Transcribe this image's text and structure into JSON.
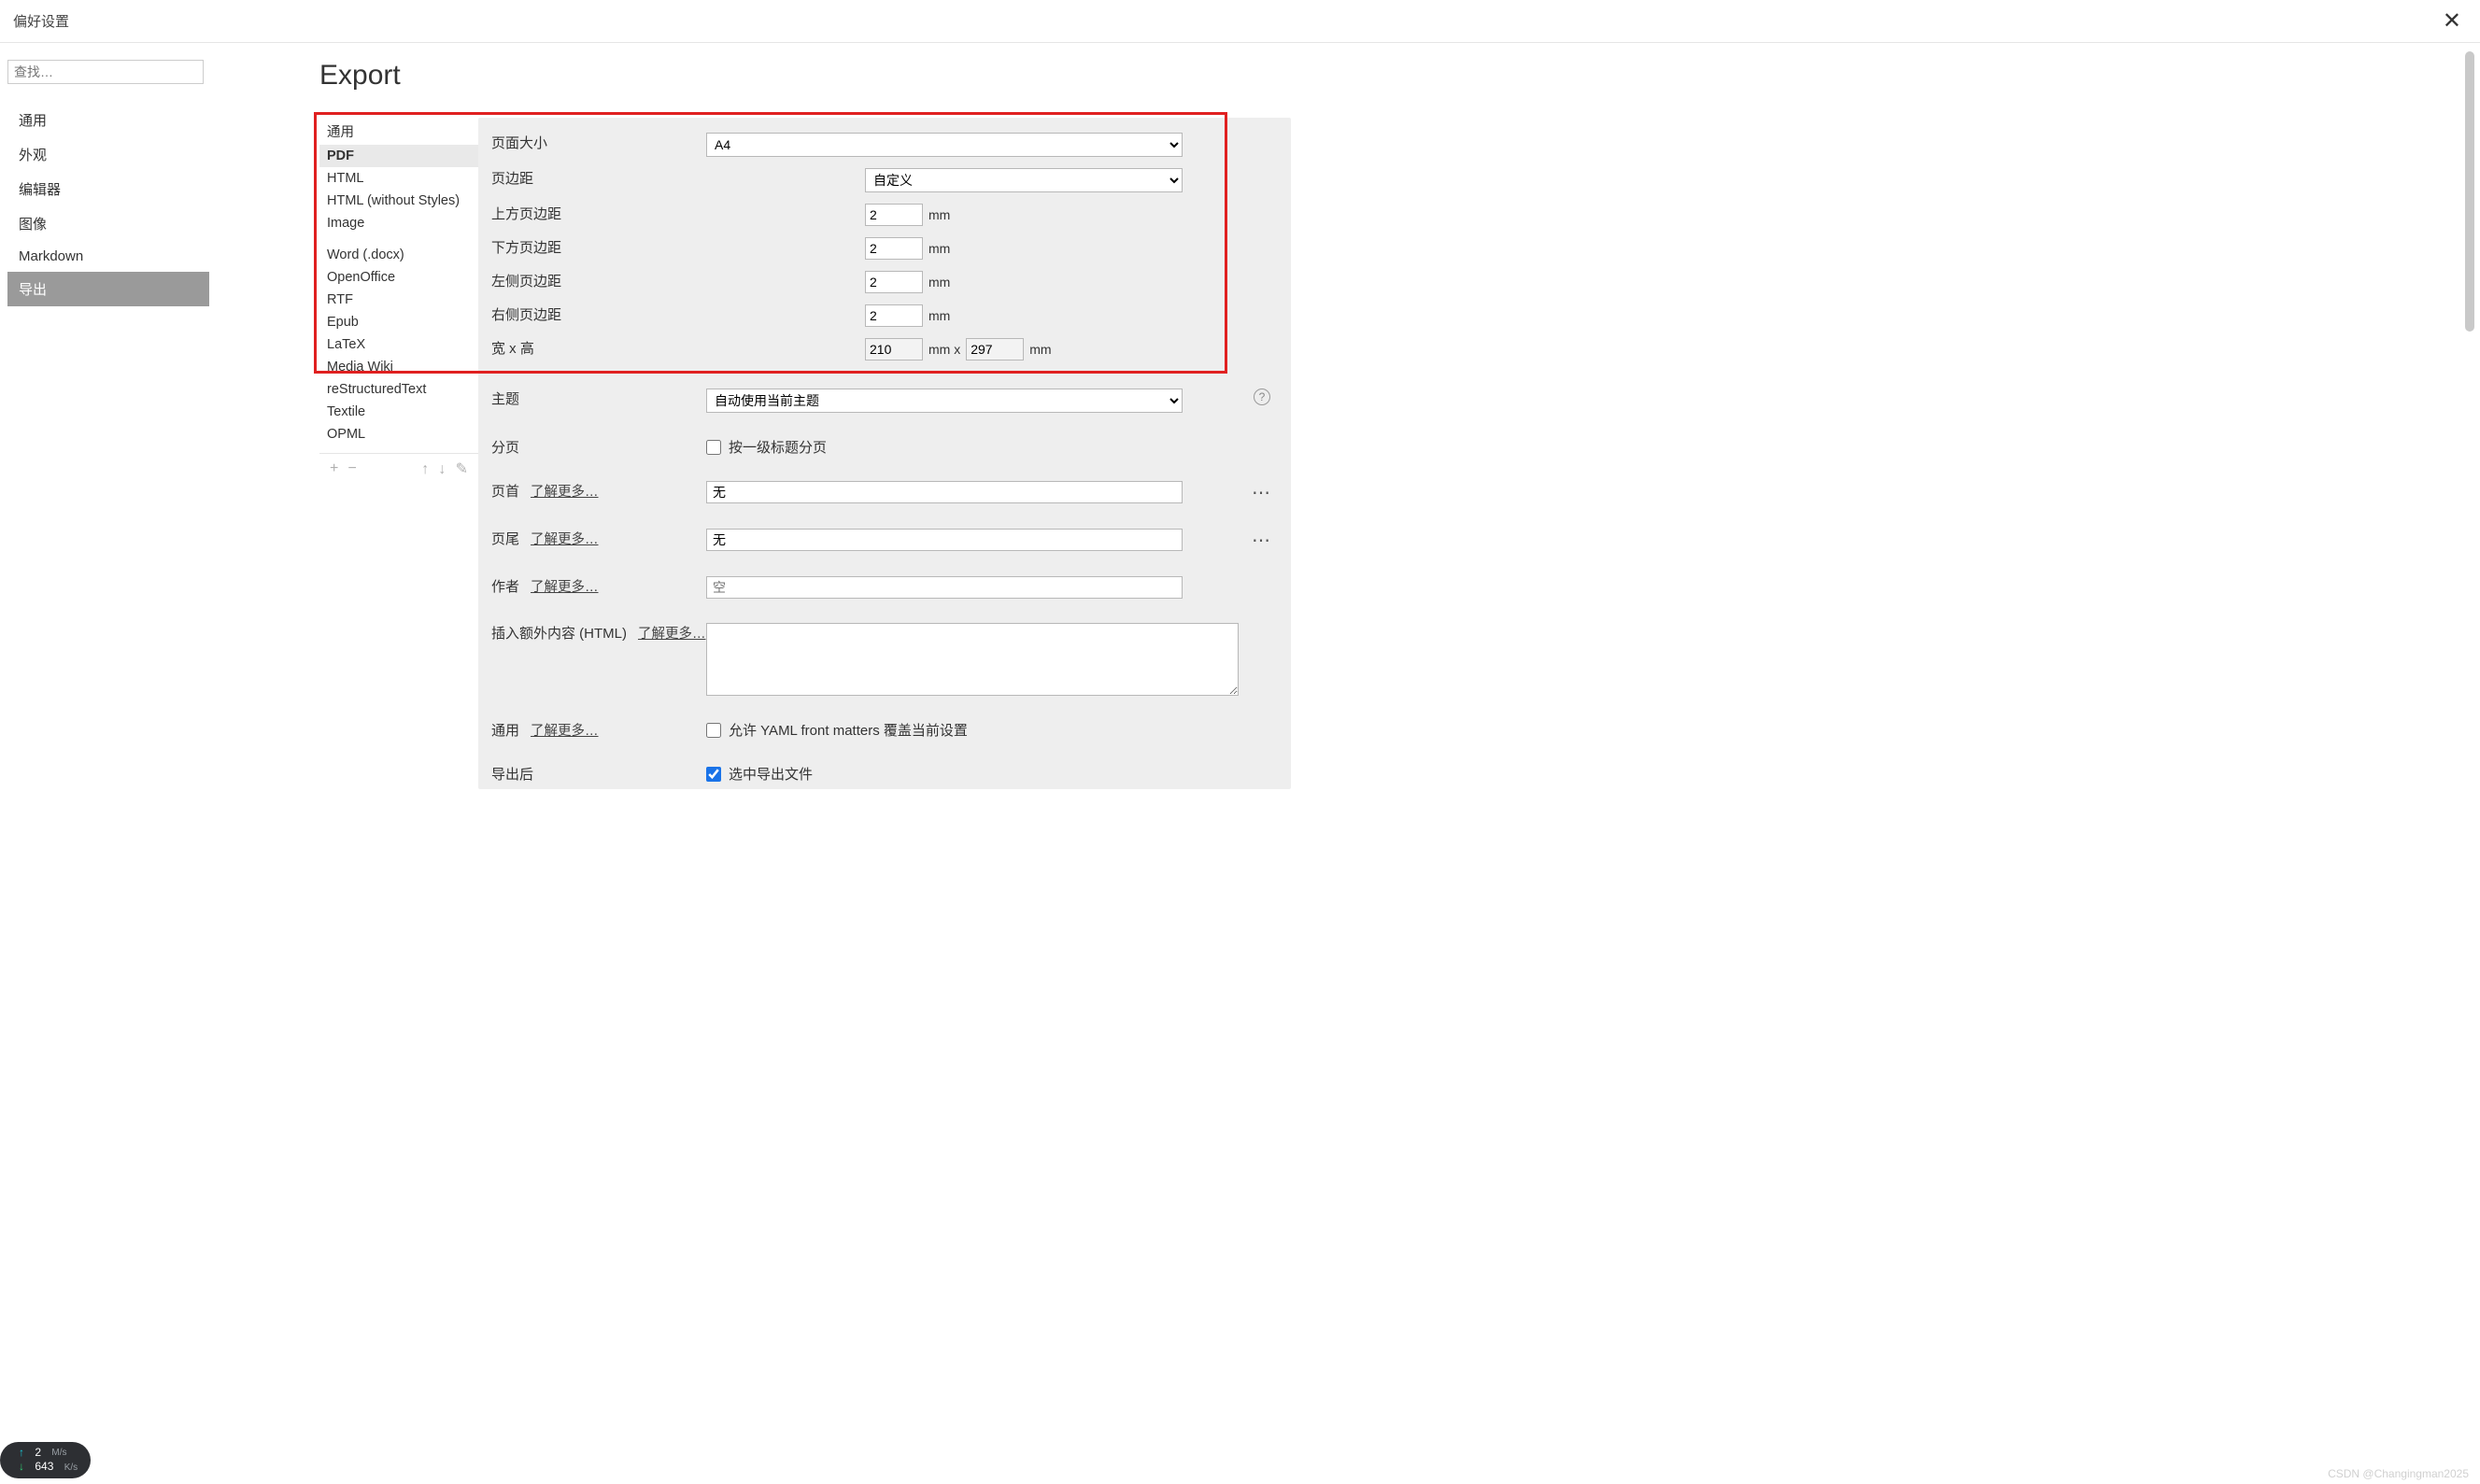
{
  "titlebar": {
    "title": "偏好设置",
    "close_aria": "Close"
  },
  "sidebar": {
    "search_placeholder": "查找…",
    "items": [
      {
        "label": "通用"
      },
      {
        "label": "外观"
      },
      {
        "label": "编辑器"
      },
      {
        "label": "图像"
      },
      {
        "label": "Markdown"
      },
      {
        "label": "导出"
      }
    ]
  },
  "page": {
    "title": "Export"
  },
  "formats": {
    "group1": [
      {
        "label": "通用"
      },
      {
        "label": "PDF"
      },
      {
        "label": "HTML"
      },
      {
        "label": "HTML (without Styles)"
      },
      {
        "label": "Image"
      }
    ],
    "group2": [
      {
        "label": "Word (.docx)"
      },
      {
        "label": "OpenOffice"
      },
      {
        "label": "RTF"
      },
      {
        "label": "Epub"
      },
      {
        "label": "LaTeX"
      },
      {
        "label": "Media Wiki"
      },
      {
        "label": "reStructuredText"
      },
      {
        "label": "Textile"
      },
      {
        "label": "OPML"
      }
    ],
    "toolbar": {
      "add": "+",
      "remove": "−",
      "up": "↑",
      "down": "↓",
      "edit": "✎"
    }
  },
  "settings": {
    "page_size": {
      "label": "页面大小",
      "value": "A4"
    },
    "margin": {
      "label": "页边距",
      "value": "自定义"
    },
    "margin_top": {
      "label": "上方页边距",
      "value": "2",
      "unit": "mm"
    },
    "margin_bottom": {
      "label": "下方页边距",
      "value": "2",
      "unit": "mm"
    },
    "margin_left": {
      "label": "左侧页边距",
      "value": "2",
      "unit": "mm"
    },
    "margin_right": {
      "label": "右侧页边距",
      "value": "2",
      "unit": "mm"
    },
    "wh": {
      "label": "宽 x 高",
      "w": "210",
      "between": "mm x",
      "h": "297",
      "unit": "mm"
    },
    "theme": {
      "label": "主题",
      "value": "自动使用当前主题"
    },
    "paging": {
      "label": "分页",
      "text": "按一级标题分页"
    },
    "header": {
      "label": "页首",
      "learn_more": "了解更多…",
      "value": "无"
    },
    "footer": {
      "label": "页尾",
      "learn_more": "了解更多…",
      "value": "无"
    },
    "author": {
      "label": "作者",
      "learn_more": "了解更多…",
      "placeholder": "空"
    },
    "extra_html": {
      "label": "插入额外内容 (HTML)",
      "learn_more": "了解更多…"
    },
    "general": {
      "label": "通用",
      "learn_more": "了解更多…",
      "text": "允许 YAML front matters 覆盖当前设置"
    },
    "after_export": {
      "label": "导出后",
      "text": "选中导出文件"
    }
  },
  "network": {
    "up_value": "2",
    "up_unit": "M/s",
    "down_value": "643",
    "down_unit": "K/s"
  },
  "watermark": "CSDN @Changingman2025"
}
